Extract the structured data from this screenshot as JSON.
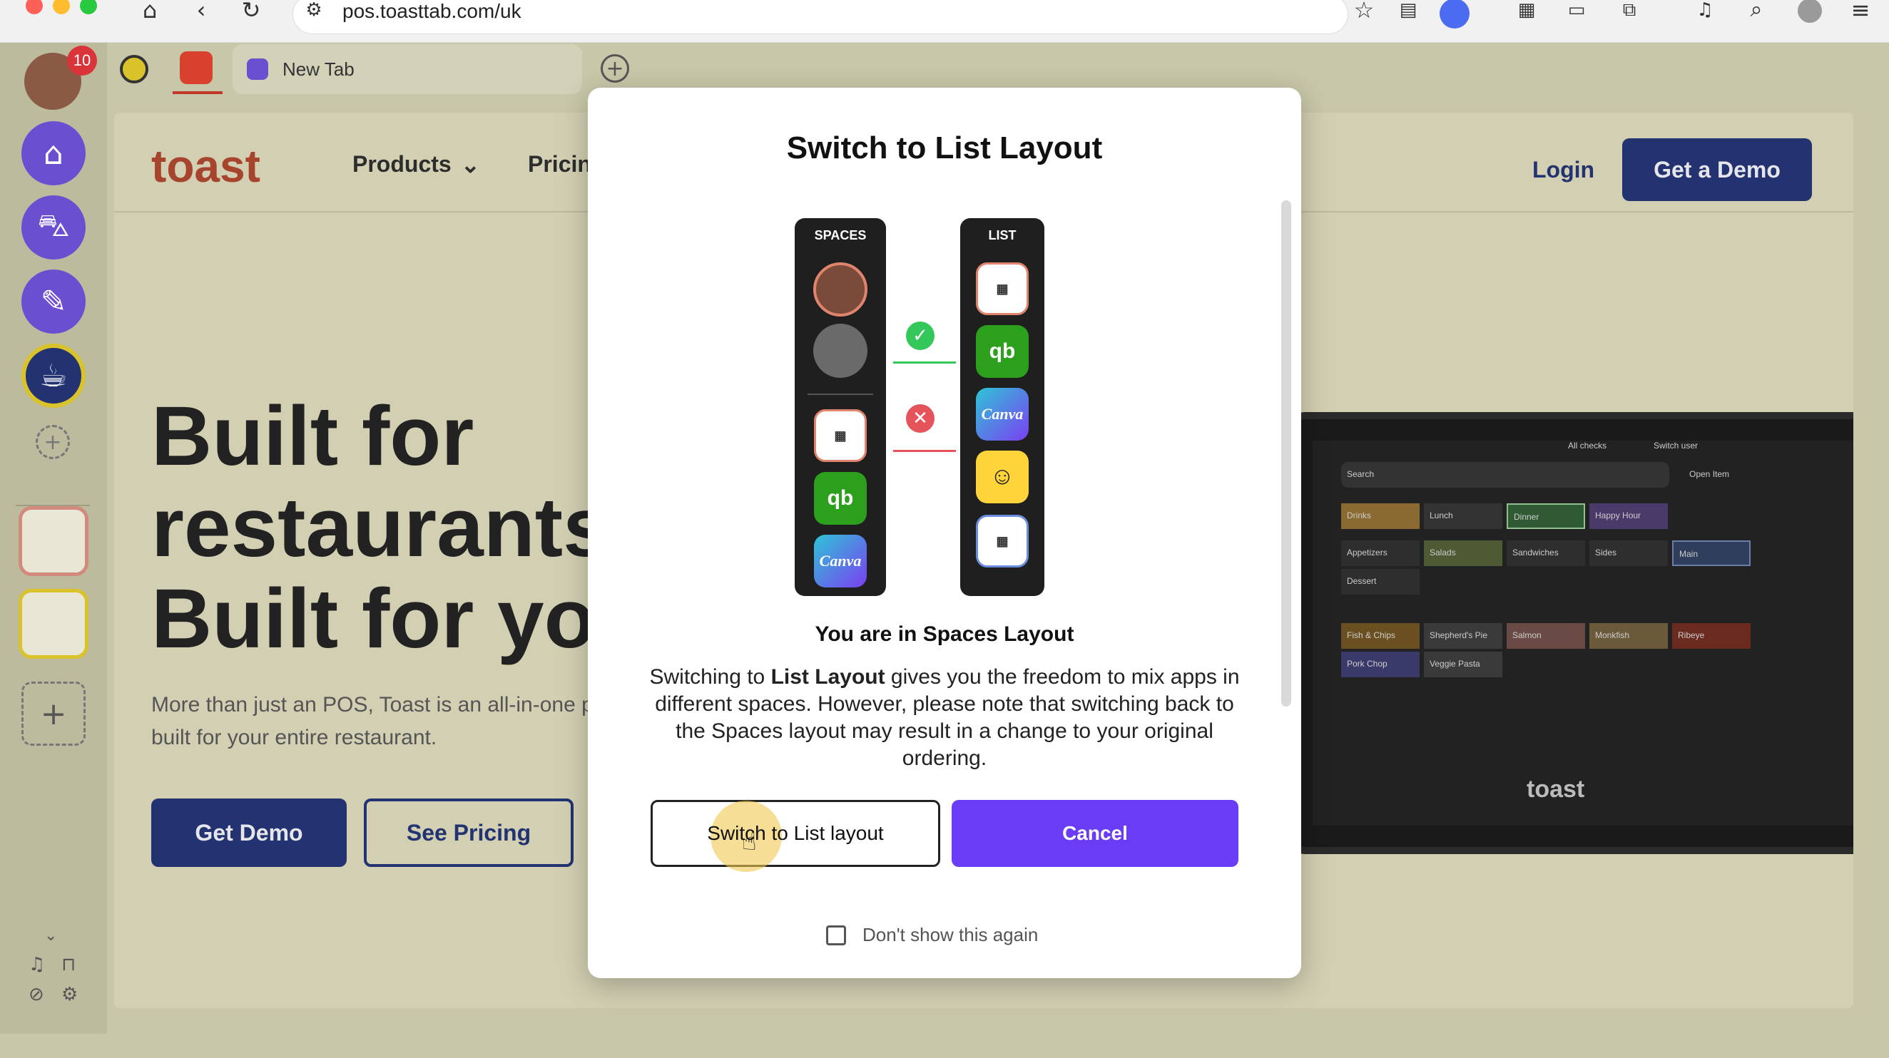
{
  "browser": {
    "url": "pos.toasttab.com/uk",
    "icons": [
      "home-icon",
      "back-icon",
      "reload-icon",
      "site-info-icon",
      "star-icon",
      "extensions-icon",
      "search-icon",
      "profile-icon",
      "menu-icon"
    ]
  },
  "sidebar": {
    "badge_count": "10",
    "items": [
      "home-space-icon",
      "basket-space-icon",
      "brush-space-icon",
      "cup-space-icon"
    ]
  },
  "tabs": {
    "new_tab_label": "New Tab"
  },
  "website": {
    "logo": "toast",
    "nav": {
      "products": "Products",
      "pricing": "Pricin",
      "login": "Login",
      "get_demo": "Get a Demo"
    },
    "hero_lines": [
      "Built for",
      "restaurants",
      "Built for you"
    ],
    "hero_sub_lines": [
      "More than just an POS, Toast is an all-in-one p",
      "built for your entire restaurant."
    ],
    "get_demo_button": "Get Demo",
    "see_pricing_button": "See Pricing",
    "device_brand": "toast",
    "pos_menu": {
      "search_placeholder": "Search",
      "all_checks": "All checks",
      "switch_user": "Switch user",
      "open_item": "Open Item",
      "categories": [
        "Drinks",
        "Lunch",
        "Dinner",
        "Happy Hour"
      ],
      "subcategories": [
        "Appetizers",
        "Salads",
        "Sandwiches",
        "Sides",
        "Main",
        "Dessert"
      ],
      "items": [
        "Fish & Chips",
        "Shepherd's Pie",
        "Salmon",
        "Monkfish",
        "Ribeye",
        "Pork Chop",
        "Veggie Pasta"
      ]
    }
  },
  "modal": {
    "title": "Switch to List Layout",
    "spaces_label": "SPACES",
    "list_label": "LIST",
    "canva_label": "Canva",
    "subtitle": "You are in Spaces Layout",
    "body_prefix": "Switching to ",
    "body_bold": "List Layout",
    "body_rest": " gives you the freedom to mix apps in different spaces. However, please note that switching back to the Spaces layout may result in a change to your original ordering.",
    "switch_button": "Switch to List layout",
    "cancel_button": "Cancel",
    "dont_show": "Don't show this again",
    "colors": {
      "accent": "#6b3cf5",
      "check_green": "#34c759",
      "cross_red": "#e5535b"
    }
  }
}
